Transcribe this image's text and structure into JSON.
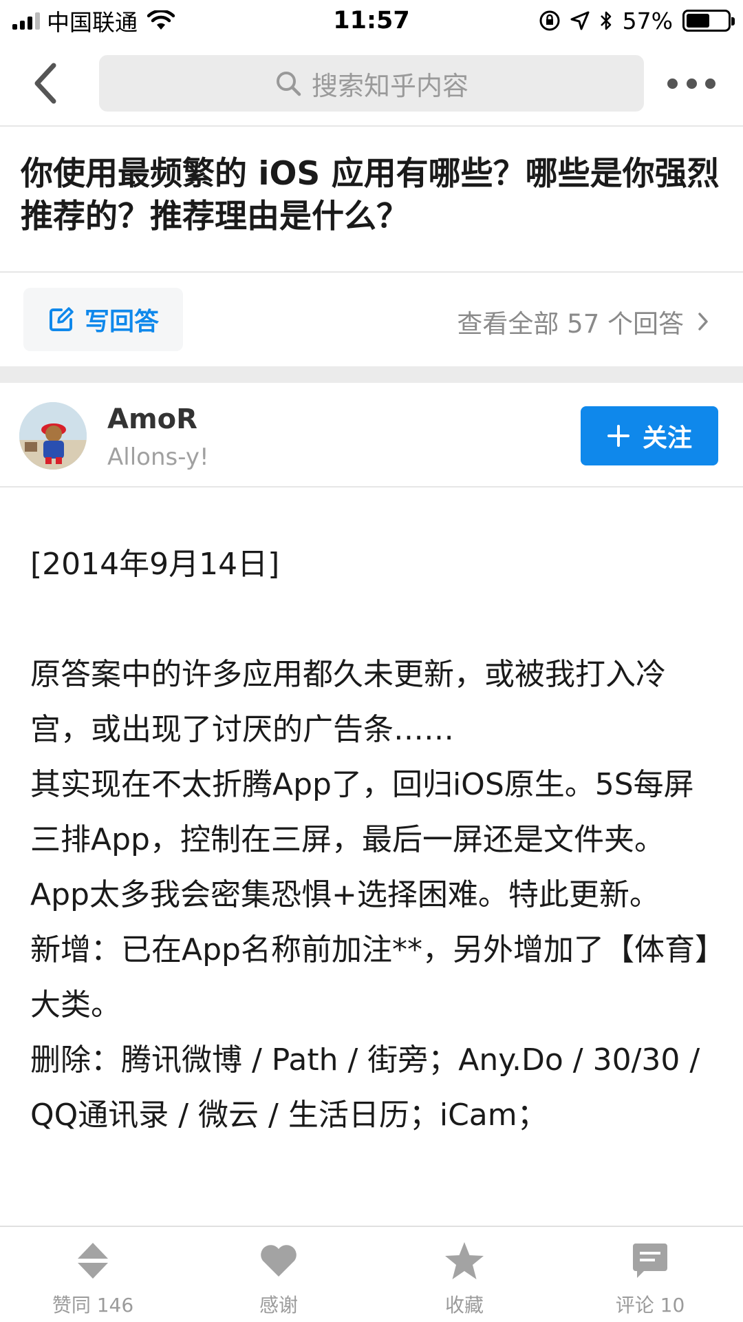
{
  "status_bar": {
    "carrier": "中国联通",
    "time": "11:57",
    "battery_percent_label": "57%",
    "battery_level": 0.57
  },
  "nav": {
    "search_placeholder": "搜索知乎内容"
  },
  "question": {
    "title": "你使用最频繁的 iOS 应用有哪些？哪些是你强烈推荐的？推荐理由是什么？",
    "write_answer_label": "写回答",
    "view_all_label": "查看全部 57 个回答"
  },
  "author": {
    "name": "AmoR",
    "bio": "Allons-y!",
    "follow_label": "关注"
  },
  "answer": {
    "date": "[2014年9月14日]",
    "paragraphs": [
      "原答案中的许多应用都久未更新，或被我打入冷宫，或出现了讨厌的广告条……",
      "其实现在不太折腾App了，回归iOS原生。5S每屏三排App，控制在三屏，最后一屏还是文件夹。",
      "App太多我会密集恐惧+选择困难。特此更新。",
      "新增：已在App名称前加注**，另外增加了【体育】大类。",
      "删除：腾讯微博 / Path / 街旁；Any.Do / 30/30 / QQ通讯录 / 微云 / 生活日历；iCam；"
    ]
  },
  "bottom_bar": {
    "items": [
      {
        "label": "赞同 146",
        "icon": "vote-icon"
      },
      {
        "label": "感谢",
        "icon": "heart-icon"
      },
      {
        "label": "收藏",
        "icon": "star-icon"
      },
      {
        "label": "评论 10",
        "icon": "comment-icon"
      }
    ]
  },
  "colors": {
    "accent": "#0f88eb",
    "muted_text": "#9b9b9b",
    "icon_gray": "#a3a3a3"
  }
}
